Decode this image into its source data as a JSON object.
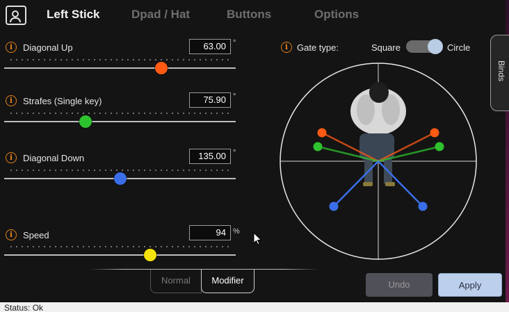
{
  "tabs": [
    {
      "label": "Left Stick",
      "active": true
    },
    {
      "label": "Dpad / Hat",
      "active": false
    },
    {
      "label": "Buttons",
      "active": false
    },
    {
      "label": "Options",
      "active": false
    }
  ],
  "sliders": [
    {
      "label": "Diagonal Up",
      "value": "63.00",
      "unit": "°",
      "level": 0.68,
      "color": "#ff5a14"
    },
    {
      "label": "Strafes (Single key)",
      "value": "75.90",
      "unit": "°",
      "level": 0.35,
      "color": "#2ec22e"
    },
    {
      "label": "Diagonal Down",
      "value": "135.00",
      "unit": "°",
      "level": 0.5,
      "color": "#3a6ee8"
    },
    {
      "label": "Speed",
      "value": "94",
      "unit": "%",
      "level": 0.63,
      "color": "#f5e20a"
    }
  ],
  "modes": {
    "normal": "Normal",
    "modifier": "Modifier",
    "active": "Modifier"
  },
  "gate": {
    "label": "Gate type:",
    "option_left": "Square",
    "option_right": "Circle",
    "selected": "Circle"
  },
  "binds_tab": "Binds",
  "buttons": {
    "undo": "Undo",
    "apply": "Apply"
  },
  "status": "Status: Ok",
  "info_glyph": "i",
  "icons": [
    "app-user-icon",
    "info-icon",
    "mouse-cursor-icon"
  ]
}
